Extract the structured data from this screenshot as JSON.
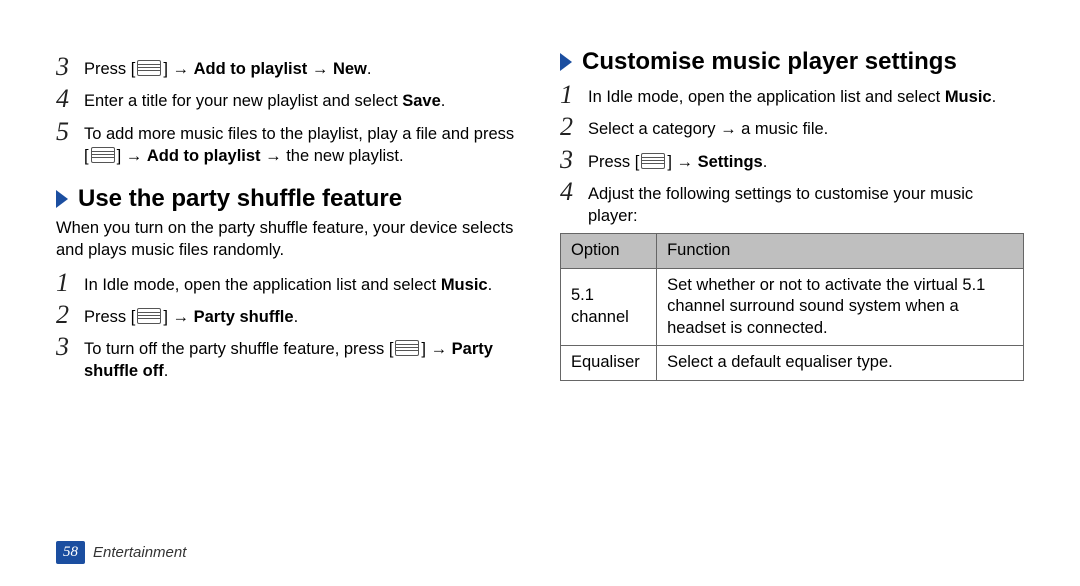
{
  "left": {
    "steps_a": [
      {
        "num": "3",
        "pre": "Press [",
        "icon": true,
        "post_plain": "] → ",
        "bold1": "Add to playlist",
        "mid": " → ",
        "bold2": "New",
        "tail": "."
      },
      {
        "num": "4",
        "pre": "Enter a title for your new playlist and select ",
        "bold1": "Save",
        "tail": "."
      },
      {
        "num": "5",
        "pre": "To add more music files to the playlist, play a file and press [",
        "icon": true,
        "post_plain": "] → ",
        "bold1": "Add to playlist",
        "mid": " → the new playlist.",
        "tail": ""
      }
    ],
    "section_b_title": "Use the party shuffle feature",
    "section_b_intro": "When you turn on the party shuffle feature, your device selects and plays music files randomly.",
    "steps_b": [
      {
        "num": "1",
        "pre": "In Idle mode, open the application list and select ",
        "bold1": "Music",
        "tail": "."
      },
      {
        "num": "2",
        "pre": "Press [",
        "icon": true,
        "post_plain": "] → ",
        "bold1": "Party shuffle",
        "tail": "."
      },
      {
        "num": "3",
        "pre": "To turn off the party shuffle feature, press [",
        "icon": true,
        "post_plain": "] → ",
        "bold1": "Party shuffle off",
        "tail": "."
      }
    ]
  },
  "right": {
    "section_title": "Customise music player settings",
    "steps": [
      {
        "num": "1",
        "pre": "In Idle mode, open the application list and select ",
        "bold1": "Music",
        "tail": "."
      },
      {
        "num": "2",
        "pre": "Select a category → a music file.",
        "tail": ""
      },
      {
        "num": "3",
        "pre": "Press [",
        "icon": true,
        "post_plain": "] → ",
        "bold1": "Settings",
        "tail": "."
      },
      {
        "num": "4",
        "pre": "Adjust the following settings to customise your music player:",
        "tail": ""
      }
    ],
    "table": {
      "head": [
        "Option",
        "Function"
      ],
      "rows": [
        [
          "5.1 channel",
          "Set whether or not to activate the virtual 5.1 channel surround sound system when a headset is connected."
        ],
        [
          "Equaliser",
          "Select a default equaliser type."
        ]
      ]
    }
  },
  "footer": {
    "page": "58",
    "section": "Entertainment"
  }
}
